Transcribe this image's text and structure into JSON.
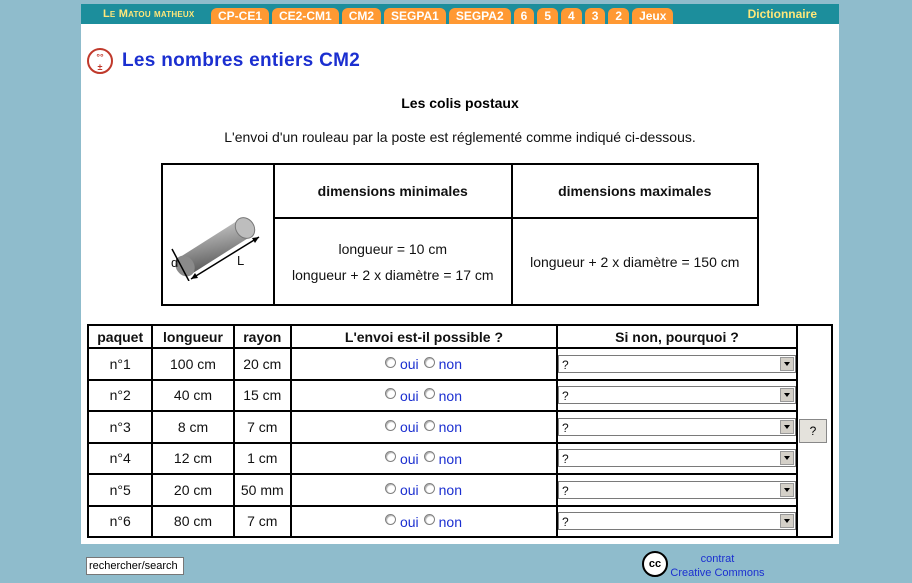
{
  "nav": {
    "brand": "Le Matou matheux",
    "tabs": [
      "CP-CE1",
      "CE2-CM1",
      "CM2",
      "SEGPA1",
      "SEGPA2",
      "6",
      "5",
      "4",
      "3",
      "2",
      "Jeux"
    ],
    "dictionary": "Dictionnaire"
  },
  "page": {
    "title": "Les nombres entiers CM2",
    "subtitle": "Les colis postaux",
    "intro": "L'envoi d'un rouleau par la poste est réglementé comme indiqué ci-dessous."
  },
  "dimensions": {
    "label_d": "d",
    "label_L": "L",
    "min_header": "dimensions minimales",
    "max_header": "dimensions maximales",
    "min_line1": "longueur = 10 cm",
    "min_line2": "longueur + 2 x diamètre = 17 cm",
    "max_line1": "longueur + 2 x diamètre = 150 cm"
  },
  "parcels": {
    "headers": {
      "paquet": "paquet",
      "longueur": "longueur",
      "rayon": "rayon",
      "possible": "L'envoi est-il possible ?",
      "why": "Si non, pourquoi ?"
    },
    "oui": "oui",
    "non": "non",
    "select_value": "?",
    "rows": [
      {
        "paquet": "n°1",
        "longueur": "100 cm",
        "rayon": "20 cm"
      },
      {
        "paquet": "n°2",
        "longueur": "40 cm",
        "rayon": "15 cm"
      },
      {
        "paquet": "n°3",
        "longueur": "8 cm",
        "rayon": "7 cm"
      },
      {
        "paquet": "n°4",
        "longueur": "12 cm",
        "rayon": "1 cm"
      },
      {
        "paquet": "n°5",
        "longueur": "20 cm",
        "rayon": "50 mm"
      },
      {
        "paquet": "n°6",
        "longueur": "80 cm",
        "rayon": "7 cm"
      }
    ]
  },
  "help_button": "?",
  "footer": {
    "search_value": "rechercher/search",
    "cc_icon_text": "cc",
    "contract_line1": "contrat",
    "contract_line2": "Creative Commons"
  }
}
